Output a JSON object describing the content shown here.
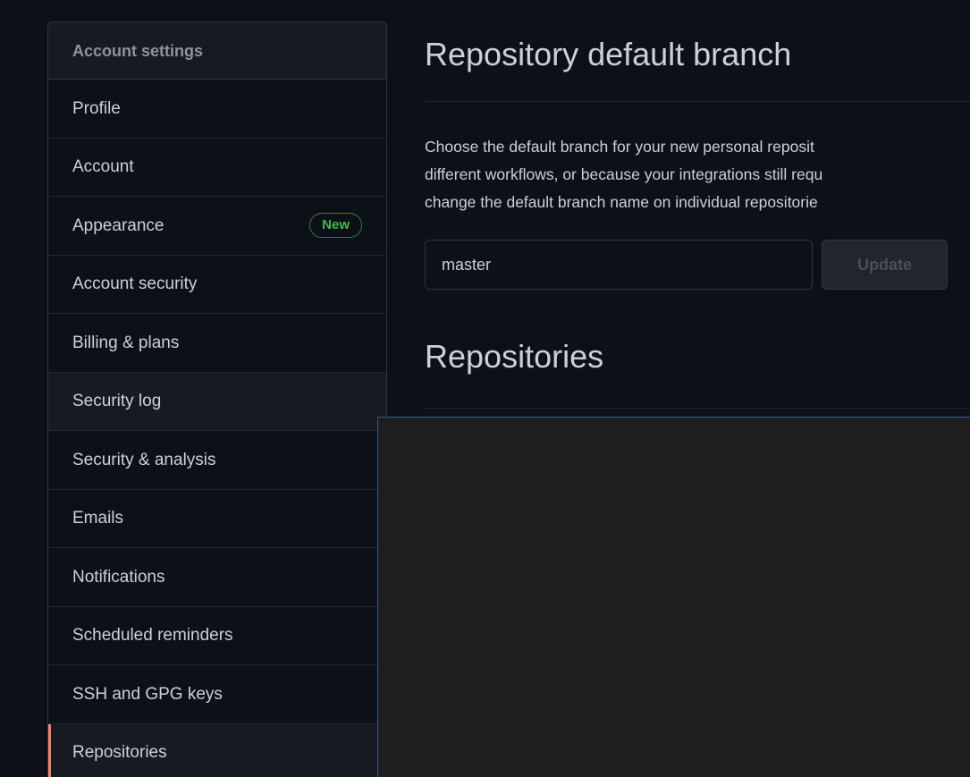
{
  "sidebar": {
    "heading": "Account settings",
    "items": [
      {
        "label": "Profile"
      },
      {
        "label": "Account"
      },
      {
        "label": "Appearance",
        "badge": "New"
      },
      {
        "label": "Account security"
      },
      {
        "label": "Billing & plans"
      },
      {
        "label": "Security log",
        "hovered": true
      },
      {
        "label": "Security & analysis"
      },
      {
        "label": "Emails"
      },
      {
        "label": "Notifications"
      },
      {
        "label": "Scheduled reminders"
      },
      {
        "label": "SSH and GPG keys"
      },
      {
        "label": "Repositories",
        "selected": true
      }
    ]
  },
  "main": {
    "title": "Repository default branch",
    "description_lines": [
      "Choose the default branch for your new personal reposit",
      "different workflows, or because your integrations still requ",
      "change the default branch name on individual repositorie"
    ],
    "branch_input_value": "master",
    "update_button_label": "Update",
    "repositories_title": "Repositories"
  },
  "colors": {
    "background": "#0d1117",
    "accent_selected": "#f78166",
    "badge_green": "#3fb950",
    "overlay": "#1e1e1e"
  }
}
